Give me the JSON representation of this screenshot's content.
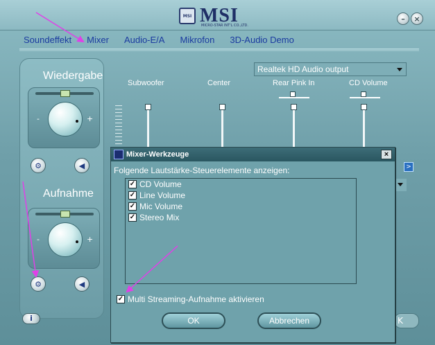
{
  "app": {
    "logo_text": "MSI",
    "logo_badge": "MSI",
    "logo_sub": "MICRO-STAR INT'L CO.,LTD."
  },
  "window_controls": {
    "minimize": "–",
    "close": "×"
  },
  "tabs": [
    {
      "label": "Soundeffekt"
    },
    {
      "label": "Mixer"
    },
    {
      "label": "Audio-E/A"
    },
    {
      "label": "Mikrofon"
    },
    {
      "label": "3D-Audio Demo"
    }
  ],
  "playback": {
    "label": "Wiedergabe",
    "minus": "-",
    "plus": "+"
  },
  "recording": {
    "label": "Aufnahme",
    "minus": "-",
    "plus": "+"
  },
  "device_select": {
    "value": "Realtek HD Audio output"
  },
  "channels": [
    {
      "label": "Subwoofer"
    },
    {
      "label": "Center"
    },
    {
      "label": "Rear Pink In"
    },
    {
      "label": "CD Volume"
    }
  ],
  "bottom": {
    "info_label": "i",
    "right_label": "K"
  },
  "dialog": {
    "title": "Mixer-Werkzeuge",
    "close": "×",
    "heading": "Folgende Lautstärke-Steuerelemente anzeigen:",
    "items": [
      {
        "label": "CD Volume",
        "checked": true
      },
      {
        "label": "Line Volume",
        "checked": true
      },
      {
        "label": "Mic Volume",
        "checked": true
      },
      {
        "label": "Stereo Mix",
        "checked": true
      }
    ],
    "multi_streaming": {
      "label": "Multi Streaming-Aufnahme aktivieren",
      "checked": true
    },
    "ok_label": "OK",
    "cancel_label": "Abbrechen"
  },
  "colors": {
    "tab_text": "#1a3aa0",
    "annotation_arrow": "#e040e8",
    "logo": "#1f2f66"
  }
}
